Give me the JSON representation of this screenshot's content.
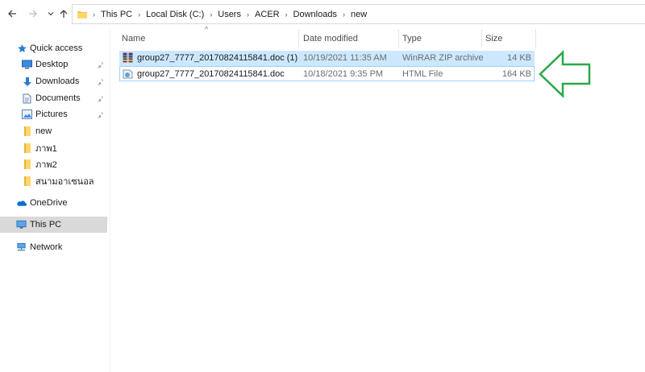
{
  "address": {
    "crumbs": [
      "This PC",
      "Local Disk (C:)",
      "Users",
      "ACER",
      "Downloads",
      "new"
    ]
  },
  "sidebar": {
    "items": [
      {
        "label": "Quick access",
        "icon": "star-icon"
      },
      {
        "label": "Desktop",
        "icon": "desktop-icon"
      },
      {
        "label": "Downloads",
        "icon": "download-arrow-icon"
      },
      {
        "label": "Documents",
        "icon": "document-icon"
      },
      {
        "label": "Pictures",
        "icon": "picture-icon"
      },
      {
        "label": "new",
        "icon": "folder-icon"
      },
      {
        "label": "ภาพ1",
        "icon": "folder-icon"
      },
      {
        "label": "ภาพ2",
        "icon": "folder-icon"
      },
      {
        "label": "สนามอาเซนอล",
        "icon": "folder-icon"
      },
      {
        "label": "OneDrive",
        "icon": "cloud-icon"
      },
      {
        "label": "This PC",
        "icon": "computer-icon"
      },
      {
        "label": "Network",
        "icon": "network-icon"
      }
    ]
  },
  "columns": {
    "name": "Name",
    "date": "Date modified",
    "type": "Type",
    "size": "Size"
  },
  "files": [
    {
      "name": "group27_7777_20170824115841.doc (1)",
      "date": "10/19/2021 11:35 AM",
      "type": "WinRAR ZIP archive",
      "size": "14 KB",
      "icon": "winrar-archive-icon"
    },
    {
      "name": "group27_7777_20170824115841.doc",
      "date": "10/18/2021 9:35 PM",
      "type": "HTML File",
      "size": "164 KB",
      "icon": "html-file-icon"
    }
  ],
  "colors": {
    "selection": "#cce8ff",
    "selected_border": "#99d1ff",
    "annotation_arrow": "#2aa84a",
    "sidebar_selected": "#d9d9d9"
  }
}
